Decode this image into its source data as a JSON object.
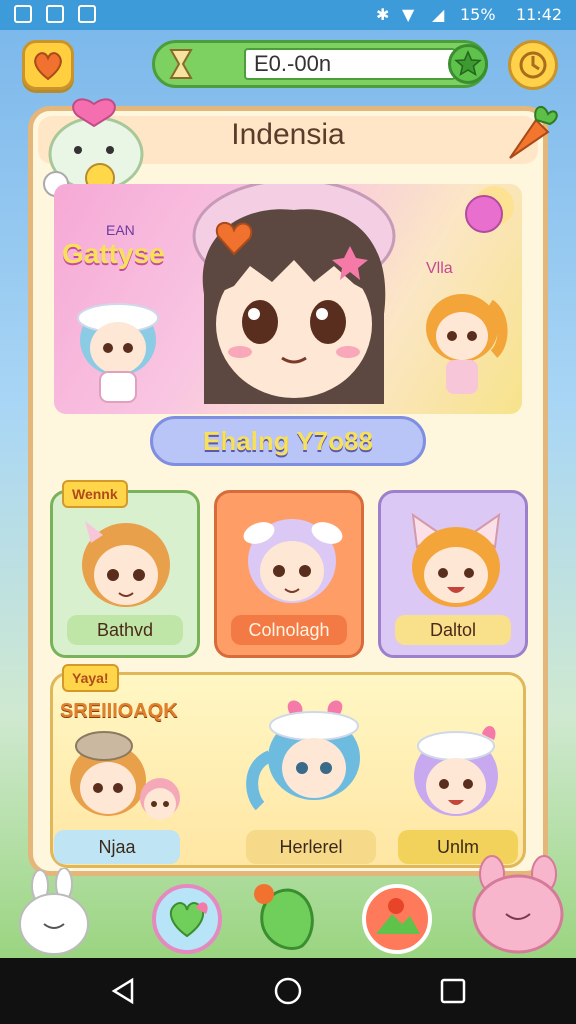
{
  "status_bar": {
    "battery": "15%",
    "time": "11:42"
  },
  "top_bar": {
    "search_value": "E0.-00n"
  },
  "panel": {
    "title": "Indensia"
  },
  "banner": {
    "sign_text": "Gattyse",
    "sign_small": "EAN",
    "side_text": "Vlla"
  },
  "featured": {
    "label": "Ehalng Y7o88"
  },
  "cards": [
    {
      "tag": "Wennk",
      "label": "Bathvd"
    },
    {
      "label": "Colnolagh"
    },
    {
      "label": "Daltol"
    }
  ],
  "group": {
    "tag": "Yaya!",
    "banner_text": "SREIIIOAQK",
    "labels": [
      "Njaa",
      "Herlerel",
      "Unlm"
    ]
  },
  "colors": {
    "accent_green": "#7cd160",
    "panel_border": "#e5b67a",
    "featured_bg": "#b9c4f7"
  },
  "icons": [
    "heart-icon",
    "clock-icon",
    "hourglass-icon",
    "star-icon",
    "back-icon",
    "home-icon",
    "recents-icon"
  ]
}
